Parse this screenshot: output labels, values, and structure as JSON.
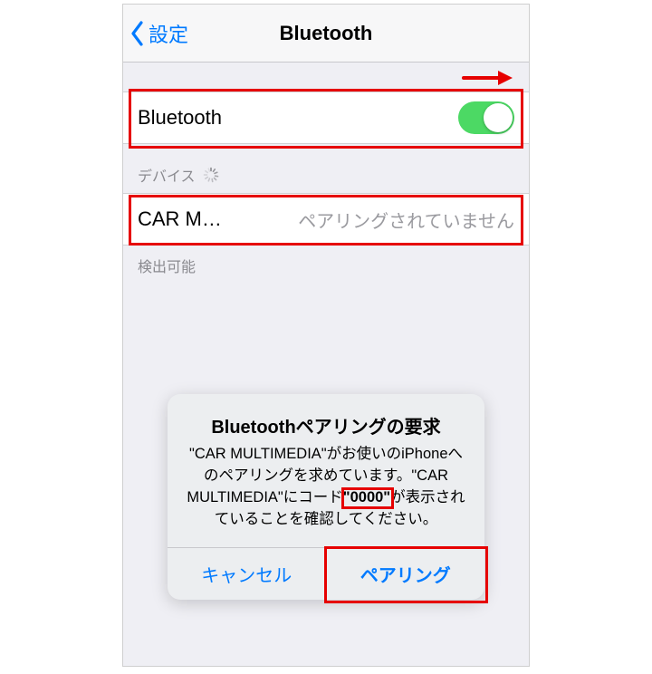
{
  "nav": {
    "back_label": "設定",
    "title": "Bluetooth"
  },
  "bluetooth_row": {
    "label": "Bluetooth",
    "on": true
  },
  "devices_section": {
    "header": "デバイス",
    "device_name": "CAR M…",
    "device_status": "ペアリングされていません",
    "footer": "検出可能"
  },
  "alert": {
    "title": "Bluetoothペアリングの要求",
    "msg_pre": "\"CAR MULTIMEDIA\"がお使いのiPhoneへのペアリングを求めています。\"CAR MULTIMEDIA\"にコード",
    "code": "\"0000\"",
    "msg_post": "が表示されていることを確認してください。",
    "cancel": "キャンセル",
    "pair": "ペアリング"
  }
}
